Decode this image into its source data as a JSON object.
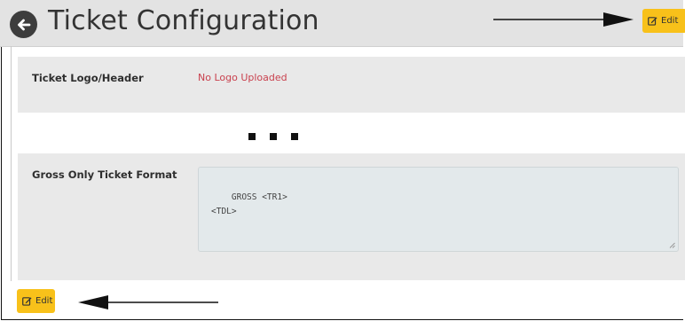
{
  "header": {
    "title": "Ticket Configuration"
  },
  "toolbar": {
    "edit_label": "Edit"
  },
  "logo_section": {
    "label": "Ticket Logo/Header",
    "value": "No Logo Uploaded"
  },
  "format_section": {
    "label": "Gross Only Ticket Format",
    "value": "GROSS <TR1>\n<TDL>"
  },
  "footer": {
    "edit_label": "Edit"
  },
  "colors": {
    "accent": "#f8c11a",
    "warning_text": "#c9414e",
    "panel": "#e9e9e9",
    "header": "#e3e3e3"
  },
  "icons": {
    "back": "arrow-left-circle-icon",
    "edit": "pencil-square-icon"
  }
}
